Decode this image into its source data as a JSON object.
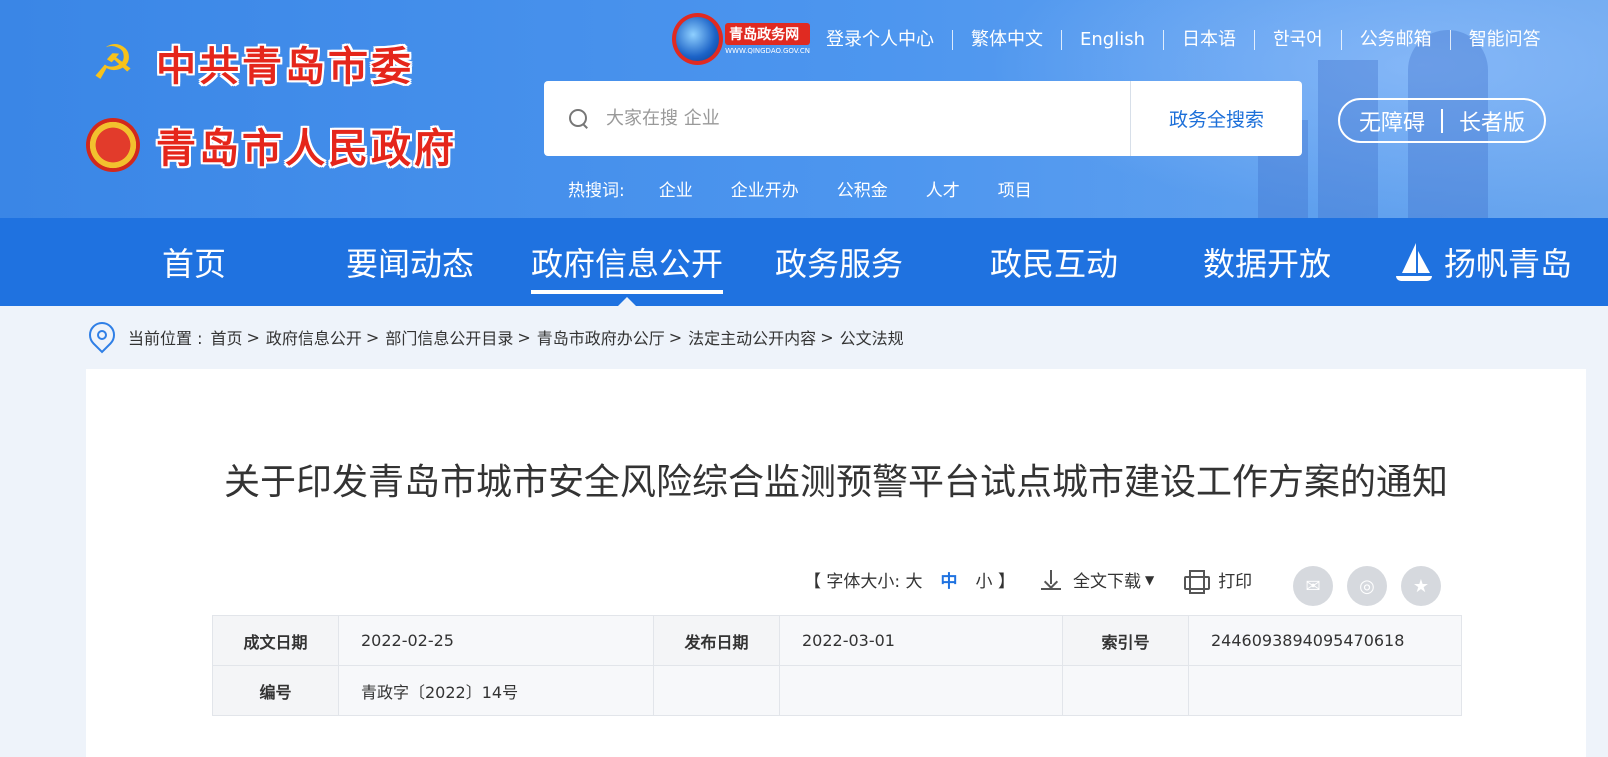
{
  "header": {
    "logo_party": "中共青岛市委",
    "logo_gov": "青岛市人民政府",
    "portal_name": "青岛政务网",
    "portal_domain": "WWW.QINGDAO.GOV.CN",
    "top_links": [
      "登录个人中心",
      "繁体中文",
      "English",
      "日本语",
      "한국어",
      "公务邮箱",
      "智能问答"
    ],
    "search": {
      "placeholder": "大家在搜 企业",
      "button": "政务全搜索"
    },
    "accessibility": {
      "barrier_free": "无障碍",
      "elder": "长者版"
    },
    "hot_label": "热搜词:",
    "hot_words": [
      "企业",
      "企业开办",
      "公积金",
      "人才",
      "项目"
    ]
  },
  "nav": {
    "items": [
      "首页",
      "要闻动态",
      "政府信息公开",
      "政务服务",
      "政民互动",
      "数据开放",
      "扬帆青岛"
    ],
    "active_index": 2
  },
  "breadcrumb": {
    "label": "当前位置 :",
    "items": [
      "首页",
      "政府信息公开",
      "部门信息公开目录",
      "青岛市政府办公厅",
      "法定主动公开内容",
      "公文法规"
    ],
    "separator": ">"
  },
  "article": {
    "title": "关于印发青岛市城市安全风险综合监测预警平台试点城市建设工作方案的通知",
    "font_size_label": "【 字体大小: 大",
    "font_mid": "中",
    "font_small": "小 】",
    "download": "全文下载",
    "print": "打印",
    "meta": {
      "written_date_label": "成文日期",
      "written_date": "2022-02-25",
      "publish_date_label": "发布日期",
      "publish_date": "2022-03-01",
      "index_label": "索引号",
      "index": "2446093894095470618",
      "number_label": "编号",
      "number": "青政字〔2022〕14号"
    }
  },
  "colors": {
    "nav_bg": "#1f72e0",
    "header_bg": "#4d96ef",
    "accent": "#1f72e0",
    "logo_red": "#e5261b"
  }
}
